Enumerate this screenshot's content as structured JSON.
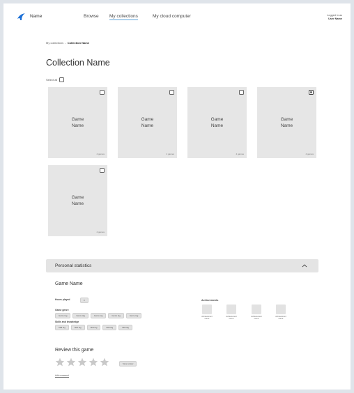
{
  "nav": {
    "app_name": "Name",
    "links": [
      "Browse",
      "My collections",
      "My cloud computer"
    ],
    "login_line1": "Logged in as",
    "login_user": "User Name"
  },
  "breadcrumb": {
    "parent": "My collections",
    "separator": "-",
    "current": "Collection Name"
  },
  "page_title": "Collection Name",
  "select_all_label": "Select all",
  "cards": [
    {
      "title_line1": "Game",
      "title_line2": "Name",
      "count": "4 games",
      "checked": false
    },
    {
      "title_line1": "Game",
      "title_line2": "Name",
      "count": "4 games",
      "checked": false
    },
    {
      "title_line1": "Game",
      "title_line2": "Name",
      "count": "4 games",
      "checked": false
    },
    {
      "title_line1": "Game",
      "title_line2": "Name",
      "count": "4 games",
      "checked": true
    },
    {
      "title_line1": "Game",
      "title_line2": "Name",
      "count": "4 games",
      "checked": false
    }
  ],
  "stats": {
    "header": "Personal statistics",
    "game_name": "Game Name",
    "hours_label": "Hours played",
    "hours_value": "0",
    "genre_label": "Game genre",
    "genre_tags": [
      "Genre tag",
      "Genre tag",
      "Genre tag",
      "Genre tag",
      "Genre tag"
    ],
    "skills_label": "Skills and knowledge",
    "skill_tags": [
      "Skill tag",
      "Skill tag",
      "Skill tag",
      "Skill tag",
      "Skill tag"
    ],
    "achievements_title": "Achievements",
    "achievements": [
      {
        "line1": "Achievement",
        "line2": "name"
      },
      {
        "line1": "Achievement",
        "line2": "name"
      },
      {
        "line1": "Achievement",
        "line2": "name"
      },
      {
        "line1": "Achievement",
        "line2": "name"
      }
    ]
  },
  "review": {
    "title": "Review this game",
    "star_count": 5,
    "save_label": "Save review",
    "add_comment": "Add comment"
  },
  "colors": {
    "background": "#dfe4ea",
    "logo": "#1b6fd6",
    "card": "#e6e6e6",
    "nav_active_underline": "#5aa0d8",
    "star": "#c9c9c9"
  }
}
